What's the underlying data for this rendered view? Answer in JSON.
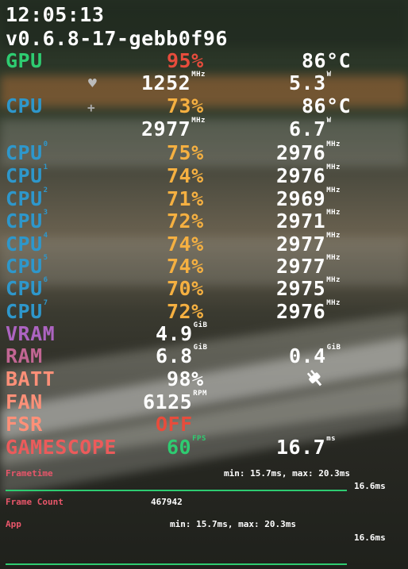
{
  "overlay": {
    "time": "12:05:13",
    "version": "v0.6.8-17-gebb0f96",
    "colors": {
      "gpu": "#2ECC71",
      "cpu": "#2E97CB",
      "load": "#F5B041",
      "vram": "#AD64C1",
      "ram": "#C26693",
      "batt": "#FF9078",
      "fan": "#FF9078",
      "fsr": "#FF9078",
      "fsr_value": "#E74C3C",
      "engine": "#EB5B5B",
      "fps": "#2ECC71",
      "graph": "#2ECC71",
      "gpu_load": "#E74C3C"
    },
    "gpu": {
      "label": "GPU",
      "load": "95%",
      "temp": "86",
      "temp_unit": "°C",
      "clock": "1252",
      "clock_unit": "MHz",
      "power": "5.3",
      "power_unit": "W",
      "icon": "heart-icon"
    },
    "cpu": {
      "label": "CPU",
      "load": "73%",
      "temp": "86",
      "temp_unit": "°C",
      "clock": "2977",
      "clock_unit": "MHz",
      "power": "6.7",
      "power_unit": "W",
      "icon": "plus-icon"
    },
    "cores": [
      {
        "label": "CPU",
        "index": "0",
        "load": "75%",
        "clock": "2976",
        "unit": "MHz"
      },
      {
        "label": "CPU",
        "index": "1",
        "load": "74%",
        "clock": "2976",
        "unit": "MHz"
      },
      {
        "label": "CPU",
        "index": "2",
        "load": "71%",
        "clock": "2969",
        "unit": "MHz"
      },
      {
        "label": "CPU",
        "index": "3",
        "load": "72%",
        "clock": "2971",
        "unit": "MHz"
      },
      {
        "label": "CPU",
        "index": "4",
        "load": "74%",
        "clock": "2977",
        "unit": "MHz"
      },
      {
        "label": "CPU",
        "index": "5",
        "load": "74%",
        "clock": "2977",
        "unit": "MHz"
      },
      {
        "label": "CPU",
        "index": "6",
        "load": "70%",
        "clock": "2975",
        "unit": "MHz"
      },
      {
        "label": "CPU",
        "index": "7",
        "load": "72%",
        "clock": "2976",
        "unit": "MHz"
      }
    ],
    "vram": {
      "label": "VRAM",
      "value": "4.9",
      "unit": "GiB"
    },
    "ram": {
      "label": "RAM",
      "value": "6.8",
      "unit": "GiB",
      "swap": "0.4",
      "swap_unit": "GiB"
    },
    "batt": {
      "label": "BATT",
      "value": "98%",
      "icon": "power-plug-icon"
    },
    "fan": {
      "label": "FAN",
      "value": "6125",
      "unit": "RPM"
    },
    "fsr": {
      "label": "FSR",
      "value": "OFF"
    },
    "engine": {
      "label": "GAMESCOPE",
      "fps": "60",
      "fps_unit": "FPS",
      "frametime": "16.7",
      "frametime_unit": "ms"
    },
    "frametime": {
      "label": "Frametime",
      "minmax": "min: 15.7ms, max: 20.3ms",
      "current": "16.6ms"
    },
    "frame_count": {
      "label": "Frame Count",
      "value": "467942"
    },
    "app": {
      "label": "App",
      "minmax": "min: 15.7ms, max: 20.3ms",
      "current": "16.6ms"
    }
  }
}
